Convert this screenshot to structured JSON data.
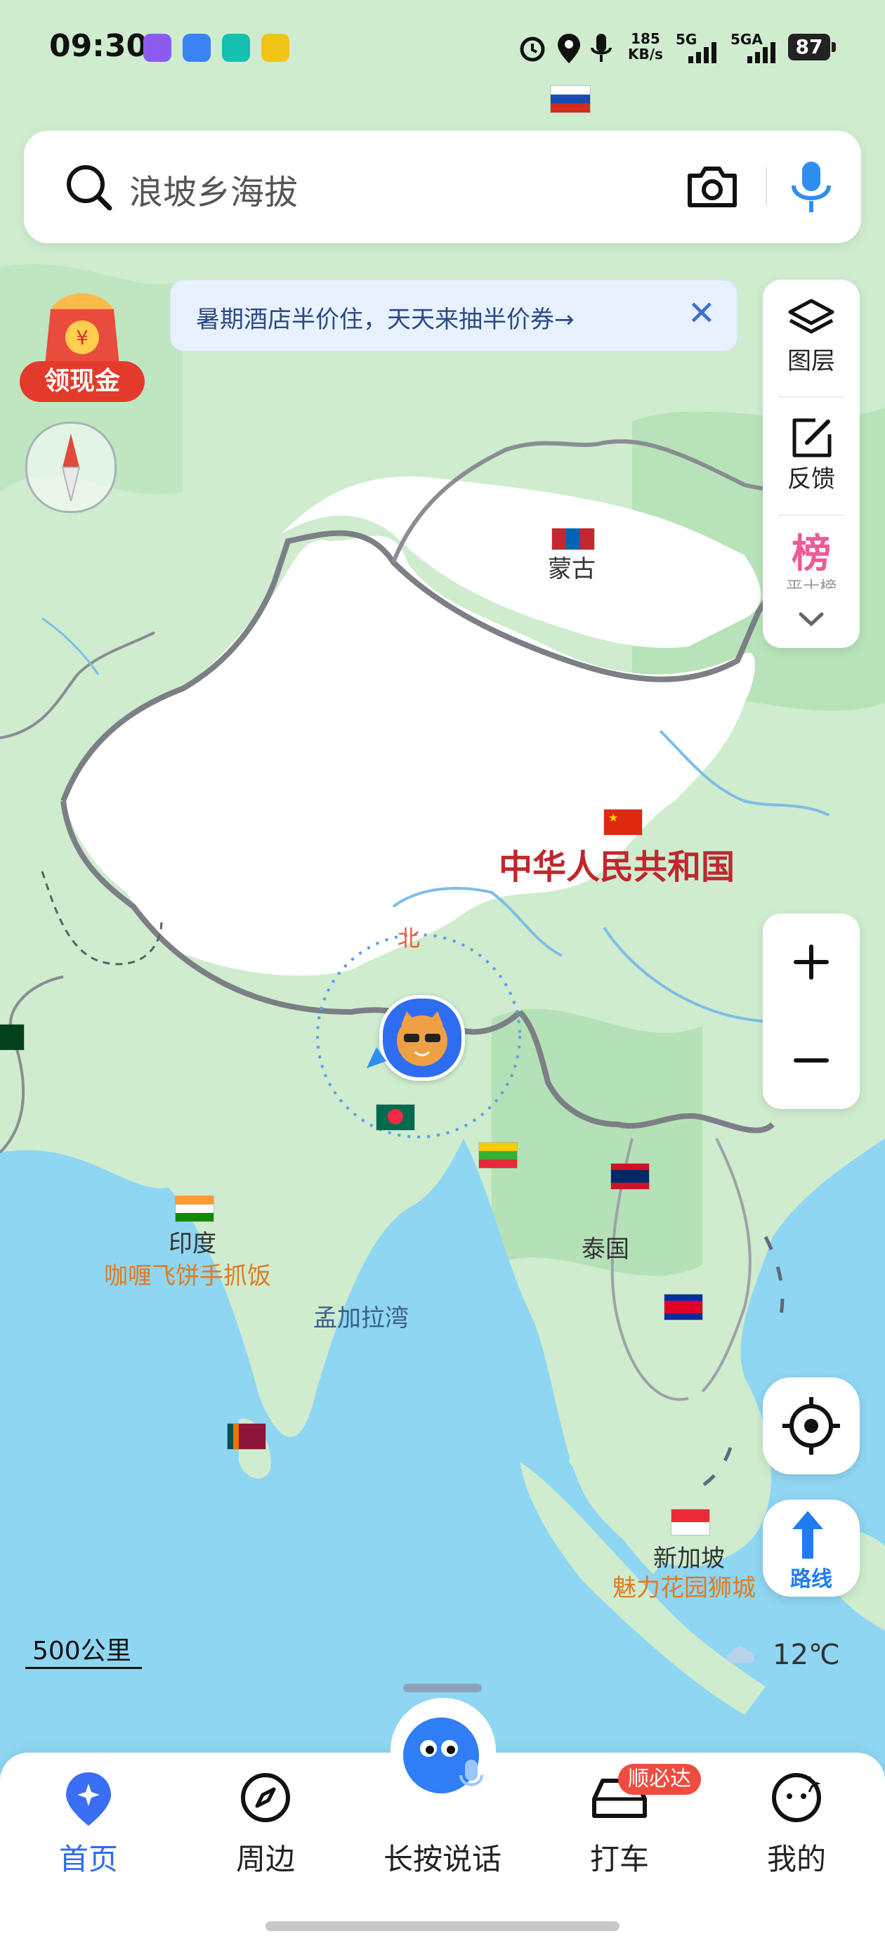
{
  "status_bar": {
    "time": "09:30",
    "net_speed_value": "185",
    "net_speed_unit": "KB/s",
    "signal1": "5G",
    "signal2": "5GA",
    "battery": "87"
  },
  "search": {
    "placeholder": "浪坡乡海拔",
    "icons": [
      "search-icon",
      "camera-icon",
      "microphone-icon"
    ]
  },
  "promo_banner": {
    "text": "暑期酒店半价住，天天来抽半价券→"
  },
  "cash_reward": {
    "label": "领现金"
  },
  "side_panel": {
    "layers_label": "图层",
    "feedback_label": "反馈",
    "rank_badge": "榜",
    "rank_sub": "平士榜"
  },
  "map_labels": {
    "mongolia": "蒙古",
    "china": "中华人民共和国",
    "india": "印度",
    "india_food": "咖喱飞饼手抓饭",
    "bay_of_bengal": "孟加拉湾",
    "thailand": "泰国",
    "singapore": "新加坡",
    "singapore_poi": "魅力花园狮城",
    "compass_north": "北"
  },
  "scale": "500公里",
  "weather": {
    "temperature": "12℃",
    "icon": "cloud-icon"
  },
  "route_button": {
    "label": "路线"
  },
  "bottom_nav": {
    "items": [
      {
        "label": "首页",
        "icon": "home-location-icon",
        "active": true
      },
      {
        "label": "周边",
        "icon": "compass-icon"
      },
      {
        "label": "长按说话",
        "icon": "voice-mascot-icon"
      },
      {
        "label": "打车",
        "icon": "car-icon",
        "badge": "顺必达"
      },
      {
        "label": "我的",
        "icon": "profile-face-icon"
      }
    ]
  },
  "colors": {
    "accent": "#2f6df0",
    "sea": "#8fd6f2",
    "land": "#cfeccf",
    "china_label": "#c0272d",
    "poi_orange": "#e07b22"
  }
}
